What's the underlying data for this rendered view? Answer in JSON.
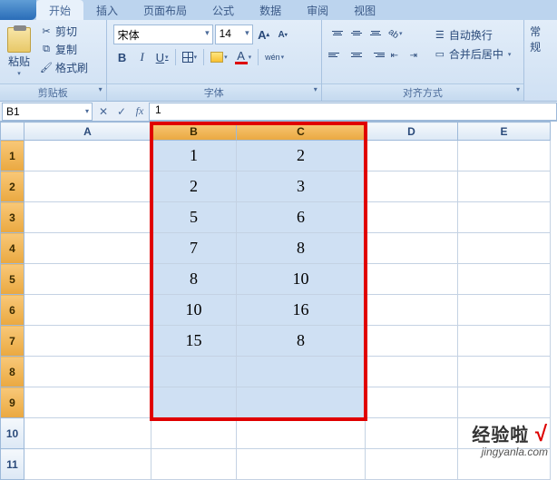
{
  "tabs": {
    "t0": "开始",
    "t1": "插入",
    "t2": "页面布局",
    "t3": "公式",
    "t4": "数据",
    "t5": "审阅",
    "t6": "视图"
  },
  "clipboard": {
    "paste": "粘贴",
    "cut": "剪切",
    "copy": "复制",
    "format_painter": "格式刷",
    "group": "剪贴板"
  },
  "font": {
    "name": "宋体",
    "size": "14",
    "group": "字体",
    "bold": "B",
    "italic": "I",
    "underline": "U",
    "wen": "wén",
    "font_color_letter": "A"
  },
  "align": {
    "group": "对齐方式",
    "wrap": "自动换行",
    "merge": "合并后居中"
  },
  "styles_label": "常规",
  "formula_bar": {
    "namebox": "B1",
    "value": "1"
  },
  "columns": {
    "A": "A",
    "B": "B",
    "C": "C",
    "D": "D",
    "E": "E"
  },
  "rows": [
    "1",
    "2",
    "3",
    "4",
    "5",
    "6",
    "7",
    "8",
    "9",
    "10",
    "11"
  ],
  "chart_data": {
    "type": "table",
    "columns": [
      "B",
      "C"
    ],
    "rows": [
      {
        "B": "1",
        "C": "2"
      },
      {
        "B": "2",
        "C": "3"
      },
      {
        "B": "5",
        "C": "6"
      },
      {
        "B": "7",
        "C": "8"
      },
      {
        "B": "8",
        "C": "10"
      },
      {
        "B": "10",
        "C": "16"
      },
      {
        "B": "15",
        "C": "8"
      },
      {
        "B": "",
        "C": ""
      },
      {
        "B": "",
        "C": ""
      }
    ]
  },
  "cells": {
    "r1B": "1",
    "r1C": "2",
    "r2B": "2",
    "r2C": "3",
    "r3B": "5",
    "r3C": "6",
    "r4B": "7",
    "r4C": "8",
    "r5B": "8",
    "r5C": "10",
    "r6B": "10",
    "r6C": "16",
    "r7B": "15",
    "r7C": "8"
  },
  "watermark": {
    "line1": "经验啦",
    "check": "√",
    "line2": "jingyanla.com"
  }
}
